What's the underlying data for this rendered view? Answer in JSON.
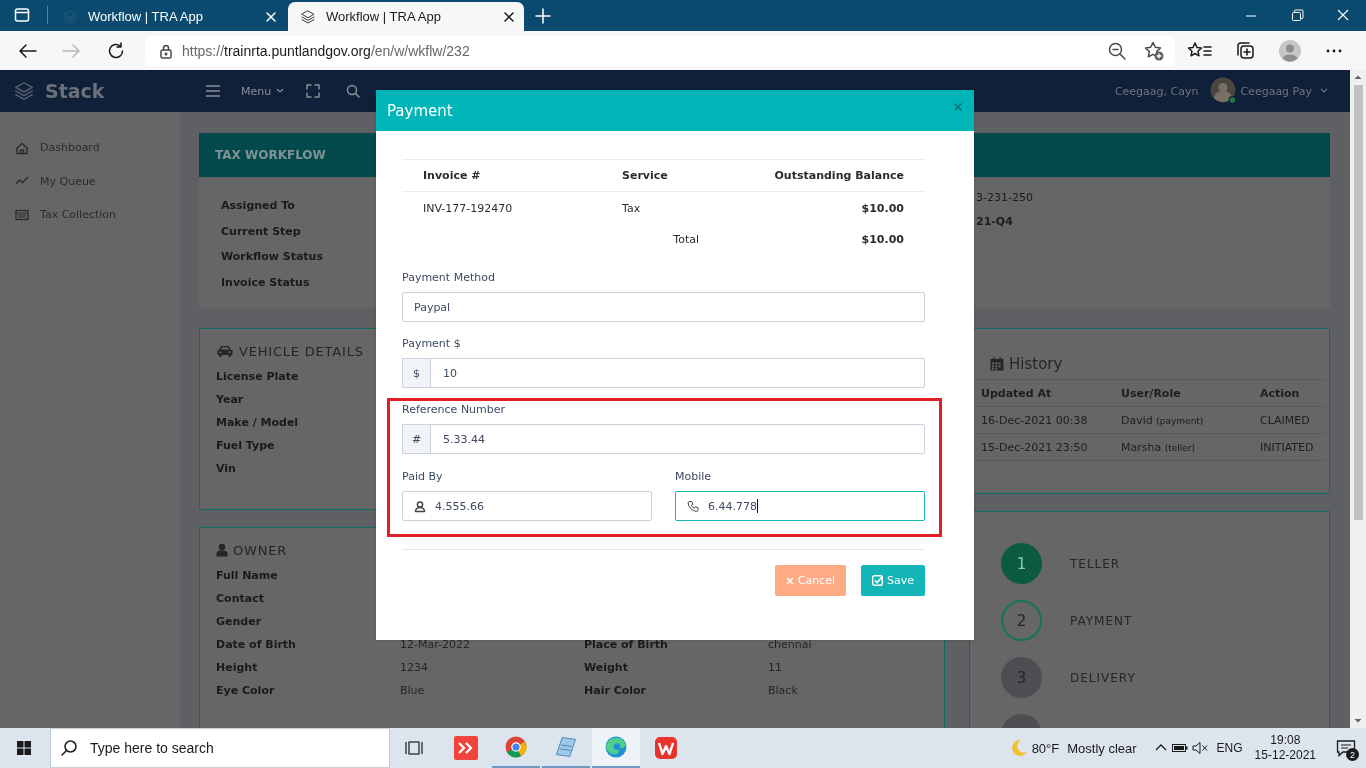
{
  "browser": {
    "tabs": [
      {
        "title": "Workflow | TRA App",
        "selected": false
      },
      {
        "title": "Workflow | TRA App",
        "selected": true
      }
    ],
    "url": {
      "scheme": "https://",
      "host": "trainrta.puntlandgov.org",
      "path": "/en/w/wkflw/232"
    }
  },
  "app": {
    "brand": "Stack",
    "menu_label": "Menu",
    "user_name": "Ceegaag, Cayn",
    "account": "Ceegaag Pay",
    "sidebar": [
      {
        "label": "Dashboard"
      },
      {
        "label": "My Queue"
      },
      {
        "label": "Tax Collection"
      }
    ],
    "workflow_card": {
      "title": "TAX WORKFLOW",
      "labels": [
        "Assigned To",
        "Current Step",
        "Workflow Status",
        "Invoice Status"
      ],
      "values": [
        {
          "text": "3-231-250",
          "bold": false
        },
        {
          "text": "21-Q4",
          "bold": true
        }
      ]
    },
    "vehicle_card": {
      "title": "VEHICLE DETAILS",
      "labels": [
        "License Plate",
        "Year",
        "Make / Model",
        "Fuel Type",
        "Vin"
      ]
    },
    "owner_card": {
      "title": "OWNER",
      "rows": [
        {
          "label": "Full Name"
        },
        {
          "label": "Contact"
        },
        {
          "label": "Gender"
        },
        {
          "label": "Date of Birth",
          "value": "12-Mar-2022",
          "label_2": "Place of Birth",
          "value_2": "chennai"
        },
        {
          "label": "Height",
          "value": "1234",
          "label_2": "Weight",
          "value_2": "11"
        },
        {
          "label": "Eye Color",
          "value": "Blue",
          "label_2": "Hair Color",
          "value_2": "Black"
        }
      ]
    },
    "history": {
      "title": "History",
      "columns": [
        "Updated At",
        "User/Role",
        "Action"
      ],
      "rows": [
        {
          "updated_at": "16-Dec-2021 00:38",
          "user": "David",
          "role": "(payment)",
          "action": "CLAIMED"
        },
        {
          "updated_at": "15-Dec-2021 23:50",
          "user": "Marsha",
          "role": "(teller)",
          "action": "INITIATED"
        }
      ]
    },
    "steps": [
      {
        "number": "1",
        "label": "TELLER",
        "kind": "done"
      },
      {
        "number": "2",
        "label": "PAYMENT",
        "kind": "current"
      },
      {
        "number": "3",
        "label": "DELIVERY",
        "kind": "pending"
      },
      {
        "kind": "pending"
      }
    ]
  },
  "modal": {
    "title": "Payment",
    "invoice_table": {
      "columns": [
        "Invoice #",
        "Service",
        "Outstanding Balance"
      ],
      "rows": [
        [
          "INV-177-192470",
          "Tax",
          "$10.00"
        ]
      ],
      "total_label": "Total",
      "total": "$10.00"
    },
    "sections": [
      {
        "highlighted": false,
        "rows": [
          [
            {
              "label": "Payment Method",
              "value": "Paypal",
              "kind": "text",
              "focused": false
            }
          ],
          [
            {
              "label": "Payment $",
              "value": "10",
              "kind": "addon",
              "addon": "$",
              "focused": false
            }
          ]
        ]
      },
      {
        "highlighted": true,
        "rows": [
          [
            {
              "label": "Reference Number",
              "value": "5.33.44",
              "kind": "addon",
              "addon": "#",
              "focused": false
            }
          ],
          [
            {
              "label": "Paid By",
              "value": "4.555.66",
              "kind": "user",
              "focused": false
            },
            {
              "label": "Mobile",
              "value": "6.44.778",
              "kind": "phone",
              "focused": true
            }
          ]
        ]
      }
    ],
    "buttons": [
      {
        "label": "Cancel",
        "kind": "cancel"
      },
      {
        "label": "Save",
        "kind": "save"
      }
    ]
  },
  "taskbar": {
    "search_placeholder": "Type here to search",
    "apps": [
      {
        "running": false,
        "active": false
      },
      {
        "running": false,
        "active": false
      },
      {
        "running": true,
        "active": false
      },
      {
        "running": true,
        "active": false
      },
      {
        "running": true,
        "active": true
      },
      {
        "running": false,
        "active": false
      }
    ],
    "weather": {
      "temperature": "80°F",
      "condition": "Mostly clear"
    },
    "language": "ENG",
    "time": "19:08",
    "date": "15-12-2021",
    "notifications": "2"
  }
}
